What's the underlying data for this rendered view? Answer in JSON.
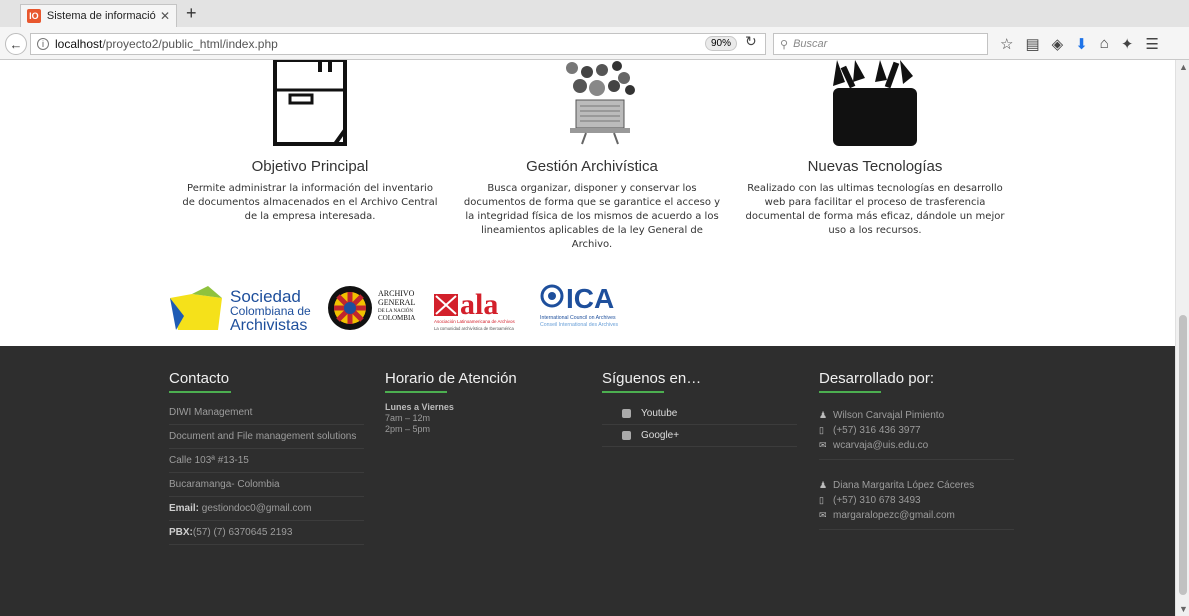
{
  "browser": {
    "tab_title": "Sistema de información para",
    "favicon_text": "IO",
    "url_host": "localhost",
    "url_path": "/proyecto2/public_html/index.php",
    "zoom": "90%",
    "search_placeholder": "Buscar"
  },
  "features": [
    {
      "title": "Objetivo Principal",
      "text": "Permite administrar la información del inventario de documentos almacenados en el Archivo Central de la empresa interesada."
    },
    {
      "title": "Gestión Archivística",
      "text": "Busca organizar, disponer y conservar los documentos de forma que se garantice el acceso y la integridad física de los mismos de acuerdo a los lineamientos aplicables de la ley General de Archivo."
    },
    {
      "title": "Nuevas Tecnologías",
      "text": "Realizado con las ultimas tecnologías en desarrollo web para facilitar el proceso de trasferencia documental de forma más eficaz, dándole un mejor uso a los recursos."
    }
  ],
  "logos": {
    "sca": [
      "Sociedad",
      "Colombiana de",
      "Archivistas"
    ],
    "agn": [
      "ARCHIVO",
      "GENERAL",
      "DE LA NACIÓN",
      "COLOMBIA"
    ],
    "ala": "ala",
    "ala_sub": "Asociación Latinoamericana de Archivos",
    "ala_tag": "La comunidad archivística de Iberoamérica",
    "ica": "ICA",
    "ica_sub": "International Council on Archives",
    "ica_sub2": "Conseil International des Archives"
  },
  "footer": {
    "contact": {
      "heading": "Contacto",
      "rows": [
        "DIWI Management",
        "Document and File management solutions",
        "Calle 103ª #13-15",
        "Bucaramanga- Colombia"
      ],
      "email_label": "Email:",
      "email": " gestiondoc0@gmail.com",
      "pbx_label": "PBX:",
      "pbx": "(57) (7) 6370645 2193"
    },
    "hours": {
      "heading": "Horario de Atención",
      "days": "Lunes a Viernes",
      "slot1": "7am – 12m",
      "slot2": "2pm – 5pm"
    },
    "social": {
      "heading": "Síguenos en…",
      "items": [
        "Youtube",
        "Google+"
      ]
    },
    "developers": {
      "heading": "Desarrollado por:",
      "people": [
        {
          "name": "Wilson Carvajal Pimiento",
          "phone": "(+57) 316 436 3977",
          "email": "wcarvaja@uis.edu.co"
        },
        {
          "name": "Diana Margarita López Cáceres",
          "phone": "(+57) 310 678 3493",
          "email": "margaralopezc@gmail.com"
        }
      ]
    }
  },
  "colors": {
    "accent": "#4caf50",
    "footer_bg": "#2e2e2e"
  }
}
